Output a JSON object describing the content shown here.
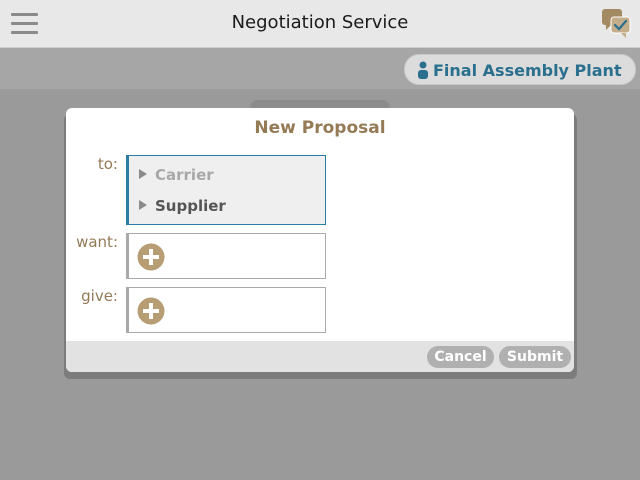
{
  "header": {
    "title": "Negotiation Service",
    "menu_icon": "hamburger-menu-icon",
    "chat_icon": "chat-bubbles-check-icon"
  },
  "sub_bar": {
    "user_badge_label": "Final Assembly Plant",
    "user_icon": "person-icon"
  },
  "modal": {
    "title": "New Proposal",
    "to_label": "to:",
    "want_label": "want:",
    "give_label": "give:",
    "recipients": [
      {
        "label": "Carrier",
        "state": "disabled"
      },
      {
        "label": "Supplier",
        "state": "enabled"
      }
    ],
    "add_icon": "plus-circle-icon",
    "cancel_label": "Cancel",
    "submit_label": "Submit"
  },
  "colors": {
    "accent_brown": "#957a56",
    "accent_blue": "#2a6f8e",
    "button_gray": "#b0b0b0"
  }
}
